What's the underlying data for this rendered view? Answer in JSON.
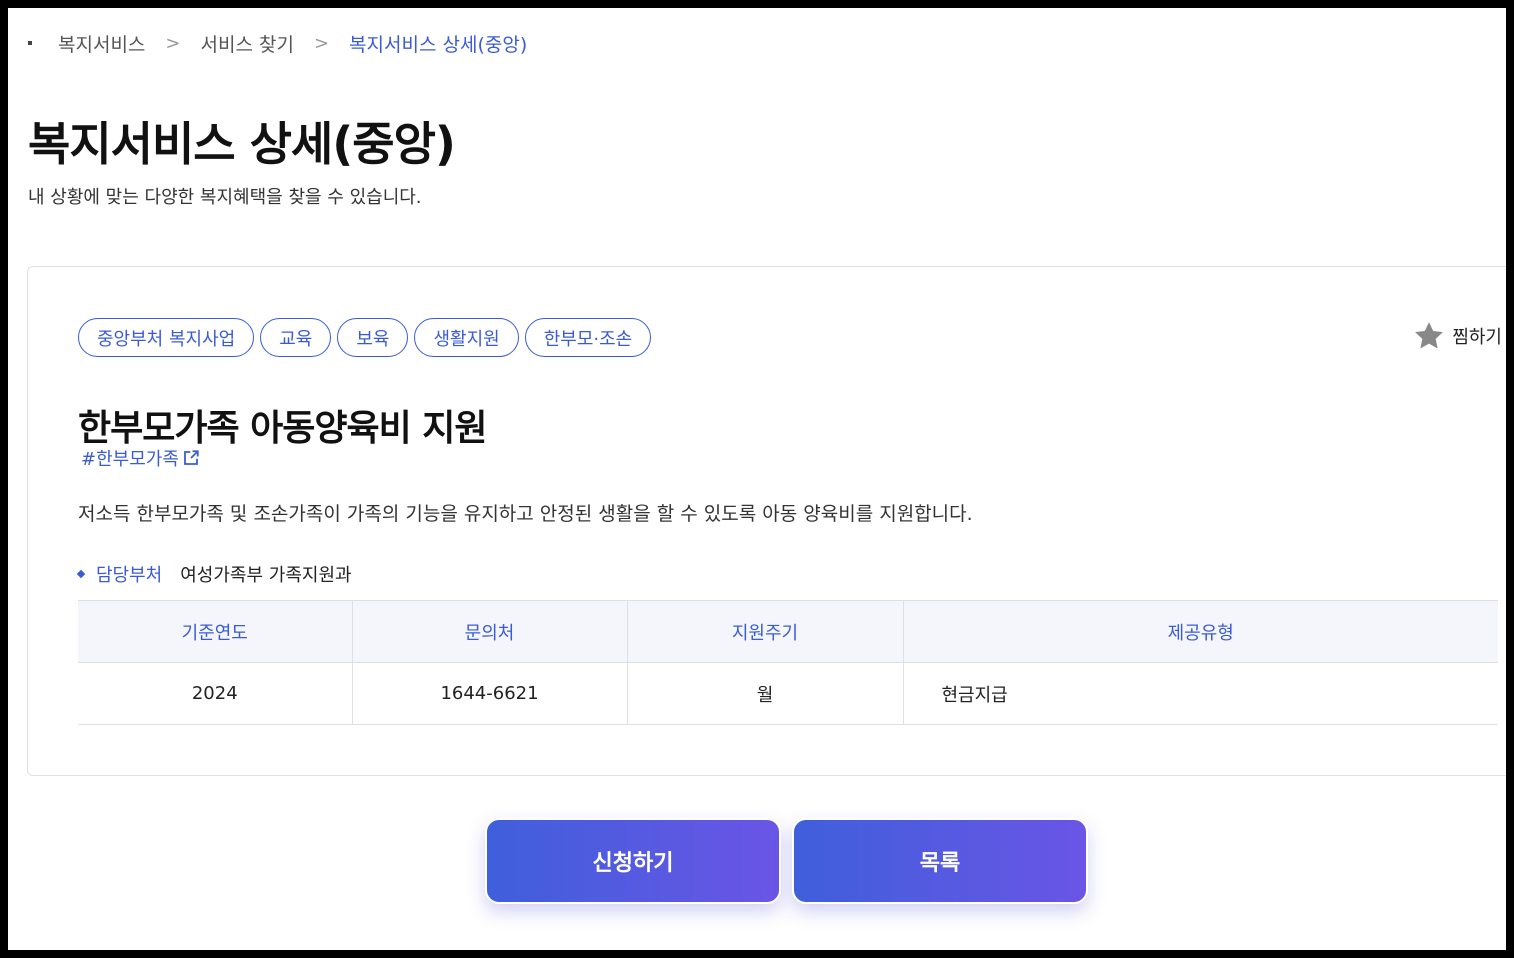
{
  "breadcrumb": {
    "items": [
      "복지서비스",
      "서비스 찾기",
      "복지서비스 상세(중앙)"
    ],
    "separator": ">"
  },
  "page": {
    "title": "복지서비스 상세(중앙)",
    "subtitle": "내 상황에 맞는 다양한 복지혜택을 찾을 수 있습니다."
  },
  "service": {
    "tags": [
      "중앙부처 복지사업",
      "교육",
      "보육",
      "생활지원",
      "한부모·조손"
    ],
    "favorite_label": "찜하기",
    "title": "한부모가족 아동양육비 지원",
    "hashtag": "#한부모가족",
    "description": "저소득 한부모가족 및 조손가족이 가족의 기능을 유지하고 안정된 생활을 할 수 있도록 아동 양육비를 지원합니다.",
    "department_label": "담당부처",
    "department_value": "여성가족부 가족지원과"
  },
  "table": {
    "headers": [
      "기준연도",
      "문의처",
      "지원주기",
      "제공유형"
    ],
    "row": [
      "2024",
      "1644-6621",
      "월",
      "현금지급"
    ]
  },
  "actions": {
    "apply_label": "신청하기",
    "list_label": "목록"
  },
  "colors": {
    "accent": "#3b5bd6",
    "button_gradient_start": "#3f5fdc",
    "button_gradient_end": "#6a55e6",
    "star": "#888888"
  },
  "icons": {
    "favorite": "star-icon",
    "hashtag_link": "external-link-icon",
    "department_bullet": "diamond-bullet-icon"
  }
}
